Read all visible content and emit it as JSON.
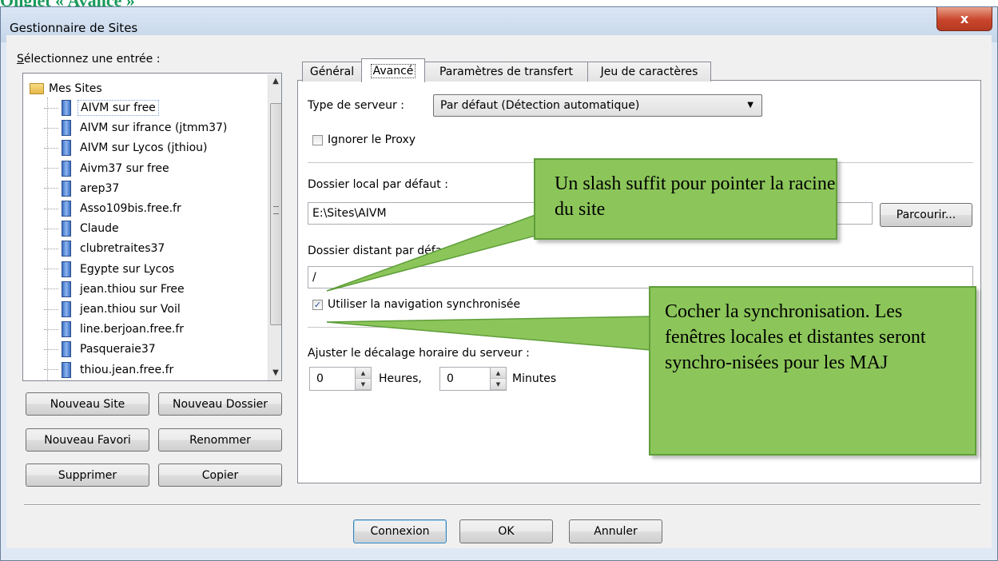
{
  "caption": "Onglet « Avancé »",
  "window": {
    "title": "Gestionnaire de Sites",
    "close_label": "x"
  },
  "left": {
    "select_label": "Sélectionnez une entrée :",
    "root": "Mes Sites",
    "sites": [
      "AIVM sur free",
      "AIVM sur ifrance (jtmm37)",
      "AIVM sur Lycos (jthiou)",
      "Aivm37 sur free",
      "arep37",
      "Asso109bis.free.fr",
      "Claude",
      "clubretraites37",
      "Egypte sur Lycos",
      "jean.thiou sur Free",
      "jean.thiou sur Voil",
      "line.berjoan.free.fr",
      "Pasqueraie37",
      "thiou.jean.free.fr"
    ],
    "buttons": {
      "new_site": "Nouveau Site",
      "new_folder": "Nouveau Dossier",
      "new_favorite": "Nouveau Favori",
      "rename": "Renommer",
      "delete": "Supprimer",
      "copy": "Copier"
    }
  },
  "tabs": [
    "Général",
    "Avancé",
    "Paramètres de transfert",
    "Jeu de caractères"
  ],
  "advanced": {
    "server_type_label": "Type de serveur :",
    "server_type_value": "Par défaut (Détection automatique)",
    "ignore_proxy": "Ignorer le Proxy",
    "local_folder_label": "Dossier local par défaut :",
    "local_folder_value": "E:\\Sites\\AIVM",
    "browse": "Parcourir...",
    "remote_folder_label": "Dossier distant par défaut :",
    "remote_folder_value": "/",
    "sync_nav": "Utiliser la navigation synchronisée",
    "sync_nav_checked": true,
    "offset_label": "Ajuster le décalage horaire du serveur :",
    "hours_value": "0",
    "hours_label": "Heures,",
    "minutes_value": "0",
    "minutes_label": "Minutes"
  },
  "callouts": {
    "slash": "Un slash suffit pour pointer la racine du site",
    "sync": "Cocher la synchronisation. Les fenêtres locales et distantes seront synchro-nisées pour les MAJ"
  },
  "footer": {
    "connect": "Connexion",
    "ok": "OK",
    "cancel": "Annuler"
  },
  "colors": {
    "callout_fill": "#8cc65a",
    "caption": "#1a9a5c",
    "close": "#c9452b"
  }
}
